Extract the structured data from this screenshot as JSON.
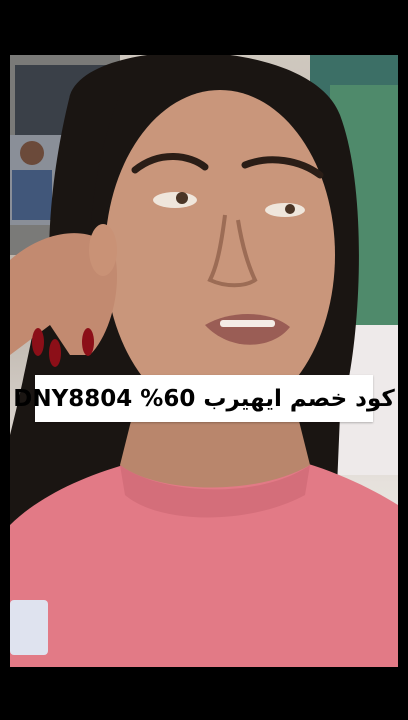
{
  "overlay": {
    "caption": "كود خصم ايهيرب 60% DNY8804"
  },
  "colors": {
    "letterbox": "#000000",
    "sweater": "#e27a86",
    "skin": "#c9967b",
    "hair": "#1a1512",
    "nails": "#8c0f18",
    "caption_bg": "#ffffff"
  },
  "icons": [
    "person-photo"
  ]
}
